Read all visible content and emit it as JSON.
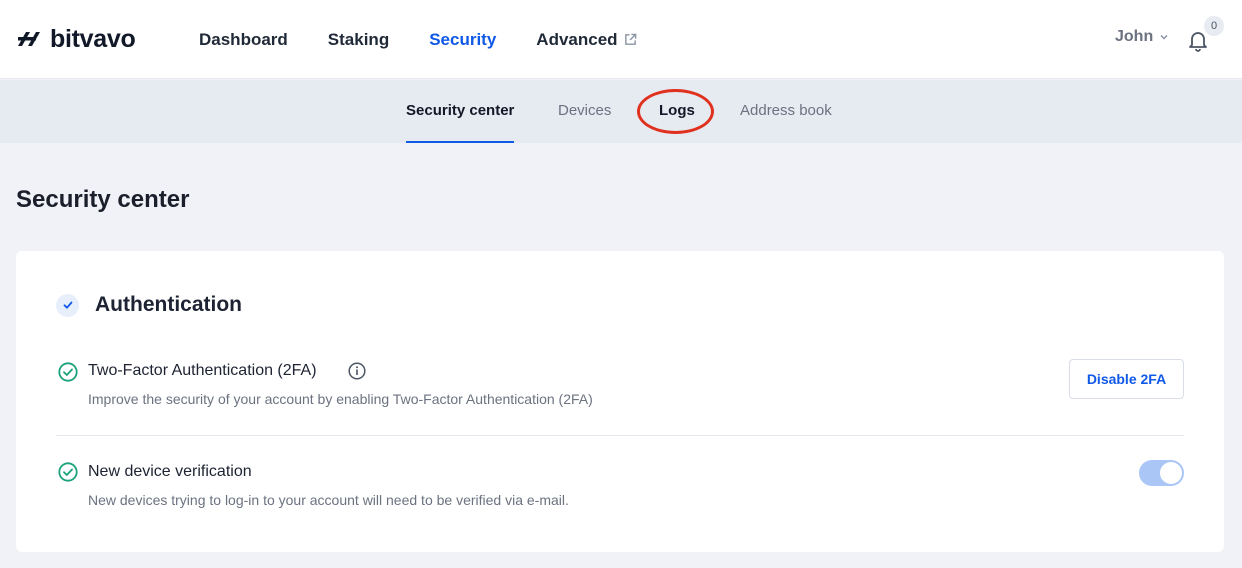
{
  "brand": {
    "name": "bitvavo"
  },
  "nav": {
    "items": [
      {
        "label": "Dashboard"
      },
      {
        "label": "Staking"
      },
      {
        "label": "Security"
      },
      {
        "label": "Advanced"
      }
    ]
  },
  "user": {
    "name": "John",
    "notification_count": "0"
  },
  "subtabs": [
    {
      "label": "Security center"
    },
    {
      "label": "Devices"
    },
    {
      "label": "Logs"
    },
    {
      "label": "Address book"
    }
  ],
  "page": {
    "title": "Security center"
  },
  "authentication": {
    "title": "Authentication",
    "two_factor": {
      "title": "Two-Factor Authentication (2FA)",
      "description": "Improve the security of your account by enabling Two-Factor Authentication (2FA)",
      "button_label": "Disable 2FA"
    },
    "device_verification": {
      "title": "New device verification",
      "description": "New devices trying to log-in to your account will need to be verified via e-mail.",
      "enabled": true
    }
  },
  "colors": {
    "accent": "#1059e8",
    "success": "#1aa37a",
    "highlight_ring": "#e0301e"
  }
}
